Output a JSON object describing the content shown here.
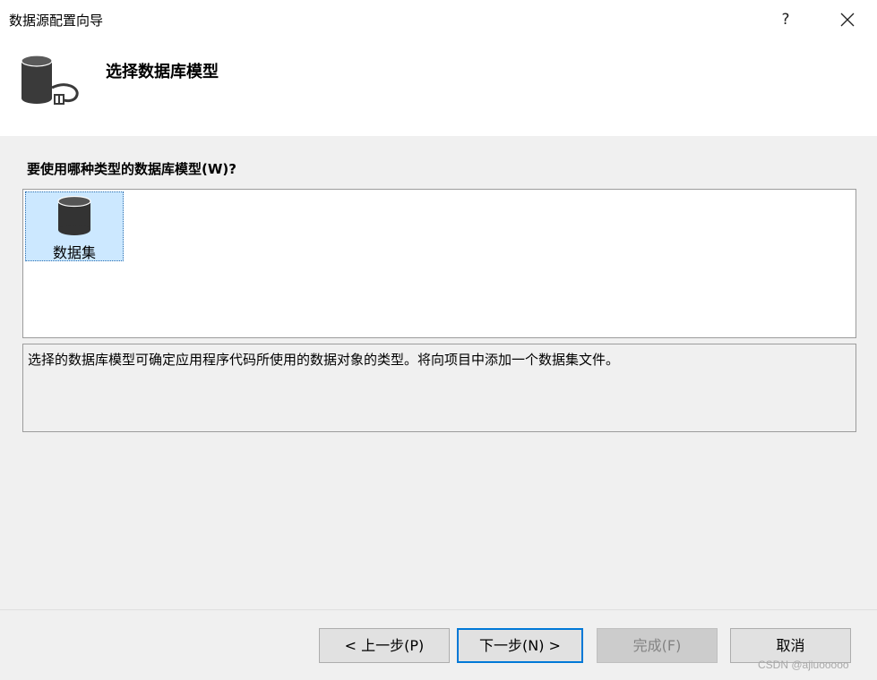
{
  "window": {
    "title": "数据源配置向导",
    "help_label": "?"
  },
  "header": {
    "heading": "选择数据库模型",
    "icon": "database-connection-icon"
  },
  "main": {
    "question": "要使用哪种类型的数据库模型(W)?",
    "models": [
      {
        "label": "数据集",
        "icon": "database-icon",
        "selected": true
      }
    ],
    "description": "选择的数据库模型可确定应用程序代码所使用的数据对象的类型。将向项目中添加一个数据集文件。"
  },
  "footer": {
    "prev_label": "< 上一步(P)",
    "next_label": "下一步(N) >",
    "finish_label": "完成(F)",
    "cancel_label": "取消"
  },
  "watermark": "CSDN @ajiuooooo",
  "colors": {
    "selection_bg": "#cce8ff",
    "default_button_border": "#0078d7",
    "dialog_bg": "#f0f0f0"
  }
}
